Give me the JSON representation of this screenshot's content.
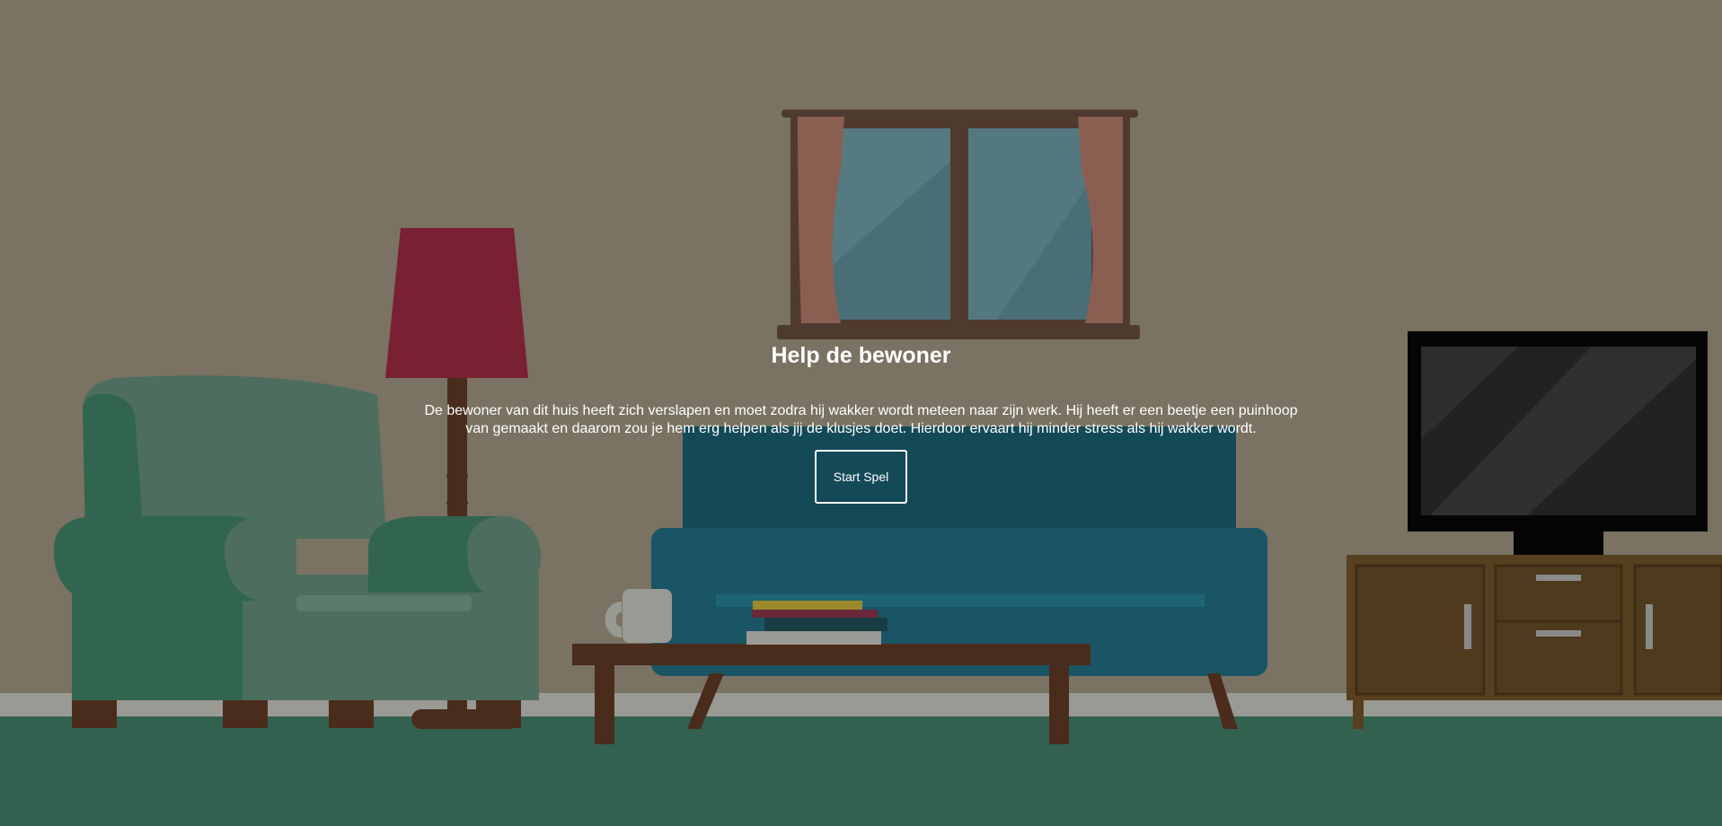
{
  "intro": {
    "title": "Help de bewoner",
    "description": "De bewoner van dit huis heeft zich verslapen en moet zodra hij wakker wordt meteen naar zijn werk. Hij heeft er een beetje een puinhoop van gemaakt en daarom zou je hem erg helpen als jij de klusjes doet. Hierdoor ervaart hij minder stress als hij wakker wordt.",
    "start_label": "Start Spel"
  },
  "scene": {
    "objects": [
      "window",
      "floor-lamp",
      "armchair",
      "sofa",
      "coffee-table",
      "mug",
      "book-stack",
      "television",
      "tv-cabinet"
    ]
  },
  "colors": {
    "wall": "#7a7262",
    "floor": "#336150",
    "baseboard": "#9a9a94",
    "sofa": "#1a5565",
    "armchair": "#316550",
    "lampshade": "#7a2033",
    "wood": "#4a2c1c",
    "cabinet": "#56401f",
    "overlay_text": "#ffffff"
  }
}
